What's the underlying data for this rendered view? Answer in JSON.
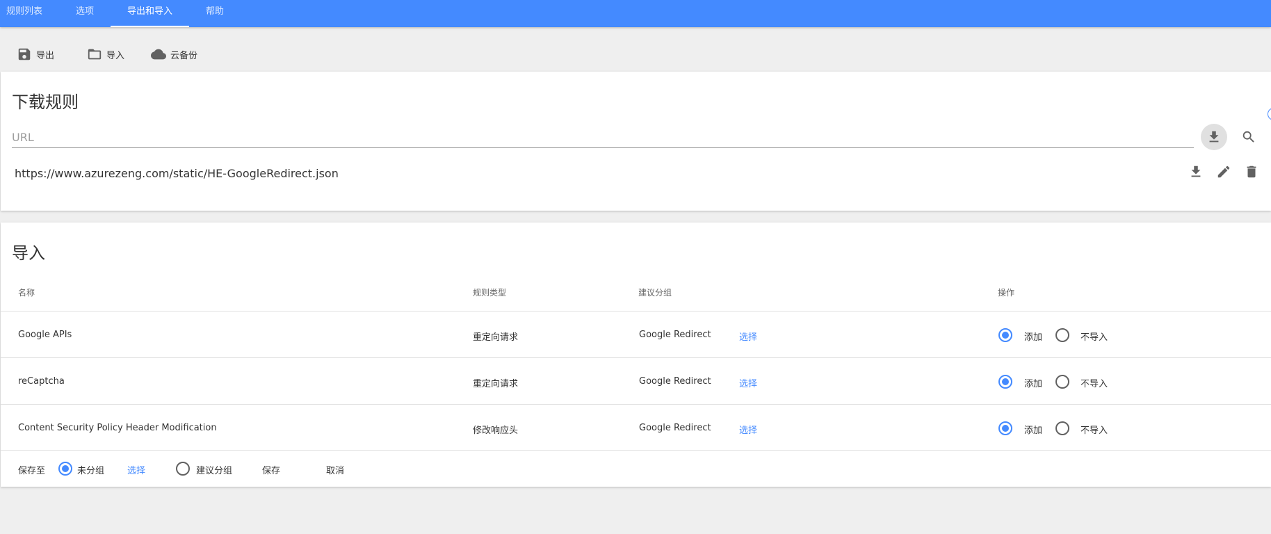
{
  "tabs": [
    {
      "label": "规则列表",
      "active": false
    },
    {
      "label": "选项",
      "active": false
    },
    {
      "label": "导出和导入",
      "active": true
    },
    {
      "label": "帮助",
      "active": false
    }
  ],
  "toolbar": {
    "export_label": "导出",
    "import_label": "导入",
    "cloud_label": "云备份"
  },
  "download": {
    "title": "下载规则",
    "url_placeholder": "URL",
    "url_value": "",
    "saved_url": "https://www.azurezeng.com/static/HE-GoogleRedirect.json"
  },
  "import": {
    "title": "导入",
    "headers": {
      "name": "名称",
      "type": "规则类型",
      "group": "建议分组",
      "action": "操作"
    },
    "rows": [
      {
        "name": "Google APIs",
        "type": "重定向请求",
        "group": "Google Redirect",
        "select": "选择",
        "add": "添加",
        "skip": "不导入",
        "choice": "add"
      },
      {
        "name": "reCaptcha",
        "type": "重定向请求",
        "group": "Google Redirect",
        "select": "选择",
        "add": "添加",
        "skip": "不导入",
        "choice": "add"
      },
      {
        "name": "Content Security Policy Header Modification",
        "type": "修改响应头",
        "group": "Google Redirect",
        "select": "选择",
        "add": "添加",
        "skip": "不导入",
        "choice": "add"
      }
    ],
    "footer": {
      "save_to": "保存至",
      "ungrouped": "未分组",
      "select": "选择",
      "suggested": "建议分组",
      "save": "保存",
      "cancel": "取消",
      "selected_option": "ungrouped"
    }
  },
  "colors": {
    "accent": "#448aff",
    "background": "#efefef",
    "card": "#ffffff"
  }
}
